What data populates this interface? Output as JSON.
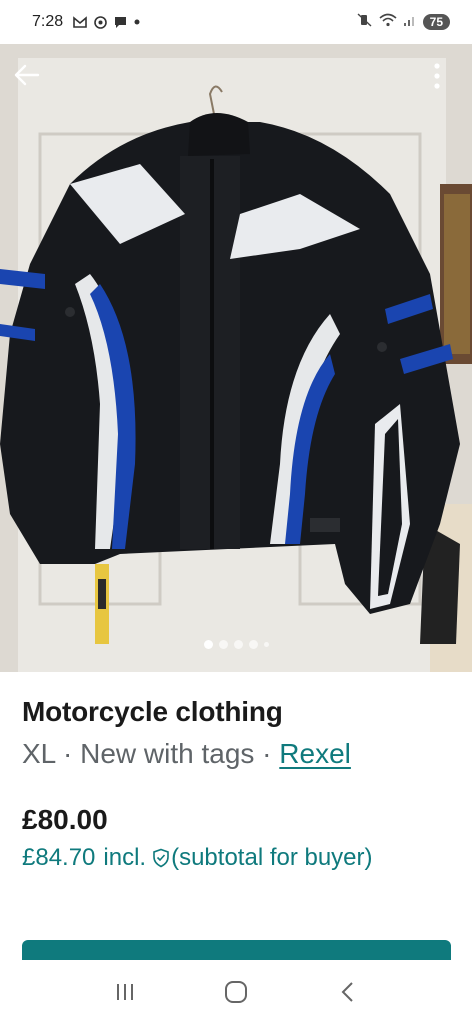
{
  "status_bar": {
    "time": "7:28",
    "left_icons": [
      "gmail-icon",
      "chrome-icon",
      "chat-icon",
      "dot-icon"
    ],
    "right_icons": [
      "mute-vibrate-icon",
      "wifi-icon",
      "signal-icon"
    ],
    "battery": "75"
  },
  "gallery": {
    "image_count": 5,
    "active_index": 0
  },
  "listing": {
    "title": "Motorcycle clothing",
    "size": "XL",
    "separator": " · ",
    "condition": "New with tags",
    "brand": "Rexel",
    "price": "£80.00",
    "buyer_price": "£84.70",
    "incl_label": "incl.",
    "buyer_note": "(subtotal for buyer)"
  },
  "colors": {
    "accent": "#0f7a7d",
    "text": "#1a1a1a",
    "muted": "#5f6468"
  }
}
